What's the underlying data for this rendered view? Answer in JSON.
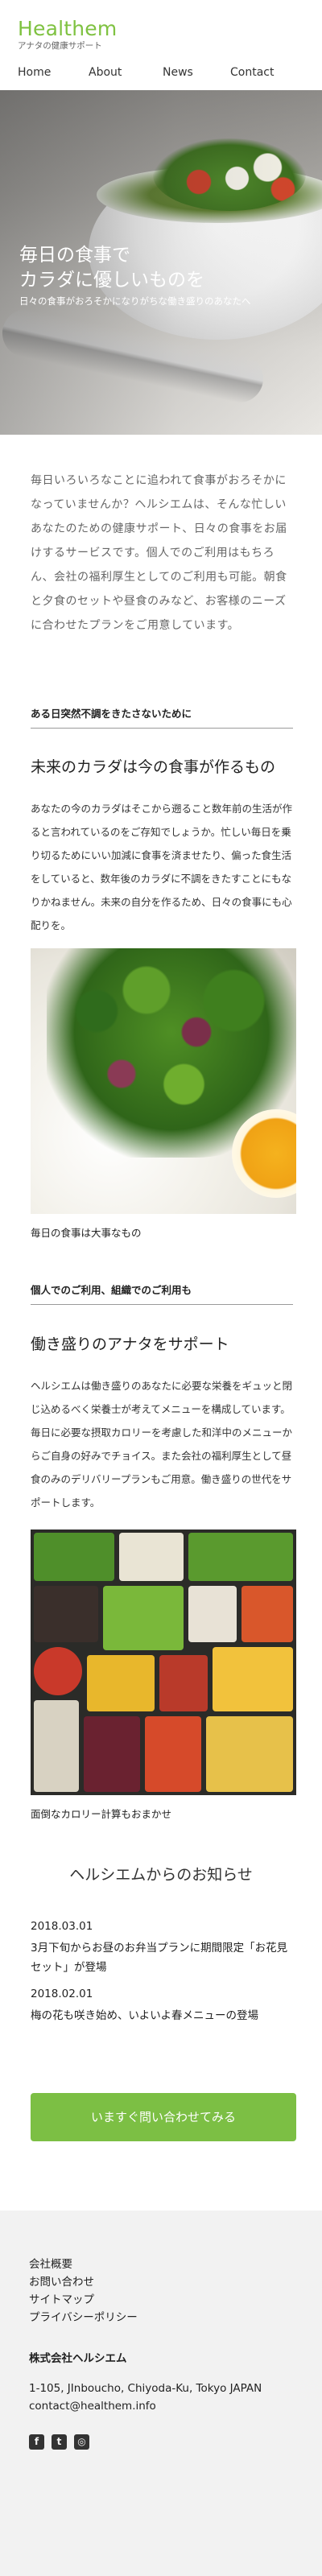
{
  "header": {
    "logo": "Healthem",
    "tagline": "アナタの健康サポート",
    "nav": [
      "Home",
      "About",
      "News",
      "Contact"
    ]
  },
  "hero": {
    "title_line1": "毎日の食事で",
    "title_line2": "カラダに優しいものを",
    "subtitle": "日々の食事がおろそかになりがちな働き盛りのあなたへ"
  },
  "intro": {
    "text": "毎日いろいろなことに追われて食事がおろそかになっていませんか？ヘルシエムは、そんな忙しいあなたのための健康サポート、日々の食事をお届けするサービスです。個人でのご利用はもちろん、会社の福利厚生としてのご利用も可能。朝食と夕食のセットや昼食のみなど、お客様のニーズに合わせたプランをご用意しています。"
  },
  "section1": {
    "label": "ある日突然不調をきたさないために",
    "title": "未来のカラダは今の食事が作るもの",
    "body": "あなたの今のカラダはそこから遡ること数年前の生活が作ると言われているのをご存知でしょうか。忙しい毎日を乗り切るためにいい加減に食事を済ませたり、偏った食生活をしていると、数年後のカラダに不調をきたすことにもなりかねません。未来の自分を作るため、日々の食事にも心配りを。",
    "caption": "毎日の食事は大事なもの"
  },
  "section2": {
    "label": "個人でのご利用、組織でのご利用も",
    "title": "働き盛りのアナタをサポート",
    "body": "ヘルシエムは働き盛りのあなたに必要な栄養をギュッと閉じ込めるべく栄養士が考えてメニューを構成しています。毎日に必要な摂取カロリーを考慮した和洋中のメニューからご自身の好みでチョイス。また会社の福利厚生として昼食のみのデリバリープランもご用意。働き盛りの世代をサポートします。",
    "caption": "面倒なカロリー計算もおまかせ"
  },
  "news": {
    "heading": "ヘルシエムからのお知らせ",
    "items": [
      {
        "date": "2018.03.01",
        "text": "3月下旬からお昼のお弁当プランに期間限定「お花見セット」が登場"
      },
      {
        "date": "2018.02.01",
        "text": "梅の花も咲き始め、いよいよ春メニューの登場"
      }
    ]
  },
  "cta": {
    "label": "いますぐ問い合わせてみる"
  },
  "footer": {
    "links": [
      "会社概要",
      "お問い合わせ",
      "サイトマップ",
      "プライバシーポリシー"
    ],
    "company": "株式会社ヘルシエム",
    "address": "1-105, JInboucho, Chiyoda-Ku, Tokyo JAPAN",
    "email": "contact@healthem.info",
    "socials": [
      "facebook-icon",
      "twitter-icon",
      "instagram-icon"
    ]
  },
  "colors": {
    "brand_green": "#7fc241",
    "cta_green": "#7cbf44",
    "footer_bg": "#f2f2f2"
  }
}
